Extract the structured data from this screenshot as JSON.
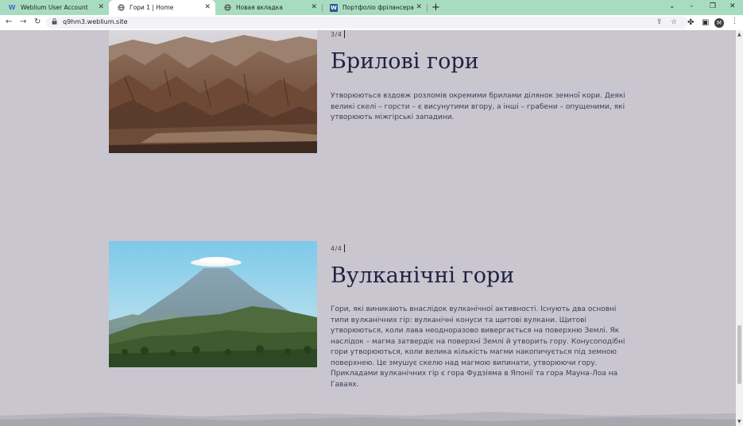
{
  "browser": {
    "tabs": [
      {
        "title": "Weblium User Account",
        "icon": "weblium-icon",
        "active": false
      },
      {
        "title": "Гори 1 | Home",
        "icon": "globe-icon",
        "active": true
      },
      {
        "title": "Новая вкладка",
        "icon": "globe-icon",
        "active": false
      },
      {
        "title": "Портфоліо фрілансера Міхту...",
        "icon": "word-icon",
        "active": false
      }
    ],
    "new_tab": "+",
    "url": "q9hm3.weblium.site",
    "avatar_letter": "M"
  },
  "sections": [
    {
      "counter": "3/4",
      "title": "Брилові гори",
      "text": "Утворюються вздовж розломів окремими брилами ділянок земної кори. Деякі великі скелі – горсти – є висунутими вгору, а інші – грабени – опущеними, які утворюють міжгірські западини."
    },
    {
      "counter": "4/4",
      "title": "Вулканічні гори",
      "text": "Гори, які виникають внаслідок вулканічної активності. Існують два основні типи вулканічних гір: вулканічні конуси та щитові вулкани. Щитові утворюються, коли лава неодноразово вивергається на поверхню Землі. Як наслідок – магма затвердіє на поверхні Землі й утворить гору. Конусоподібні гори утворюються, коли велика кількість магми накопичується під земною поверхнею. Це змушує скелю над магмою випинати, утворюючи гору. Прикладами вулканічних гір є гора Фудзіяма в Японії та гора Мауна-Лоа на Гаваях."
    }
  ]
}
